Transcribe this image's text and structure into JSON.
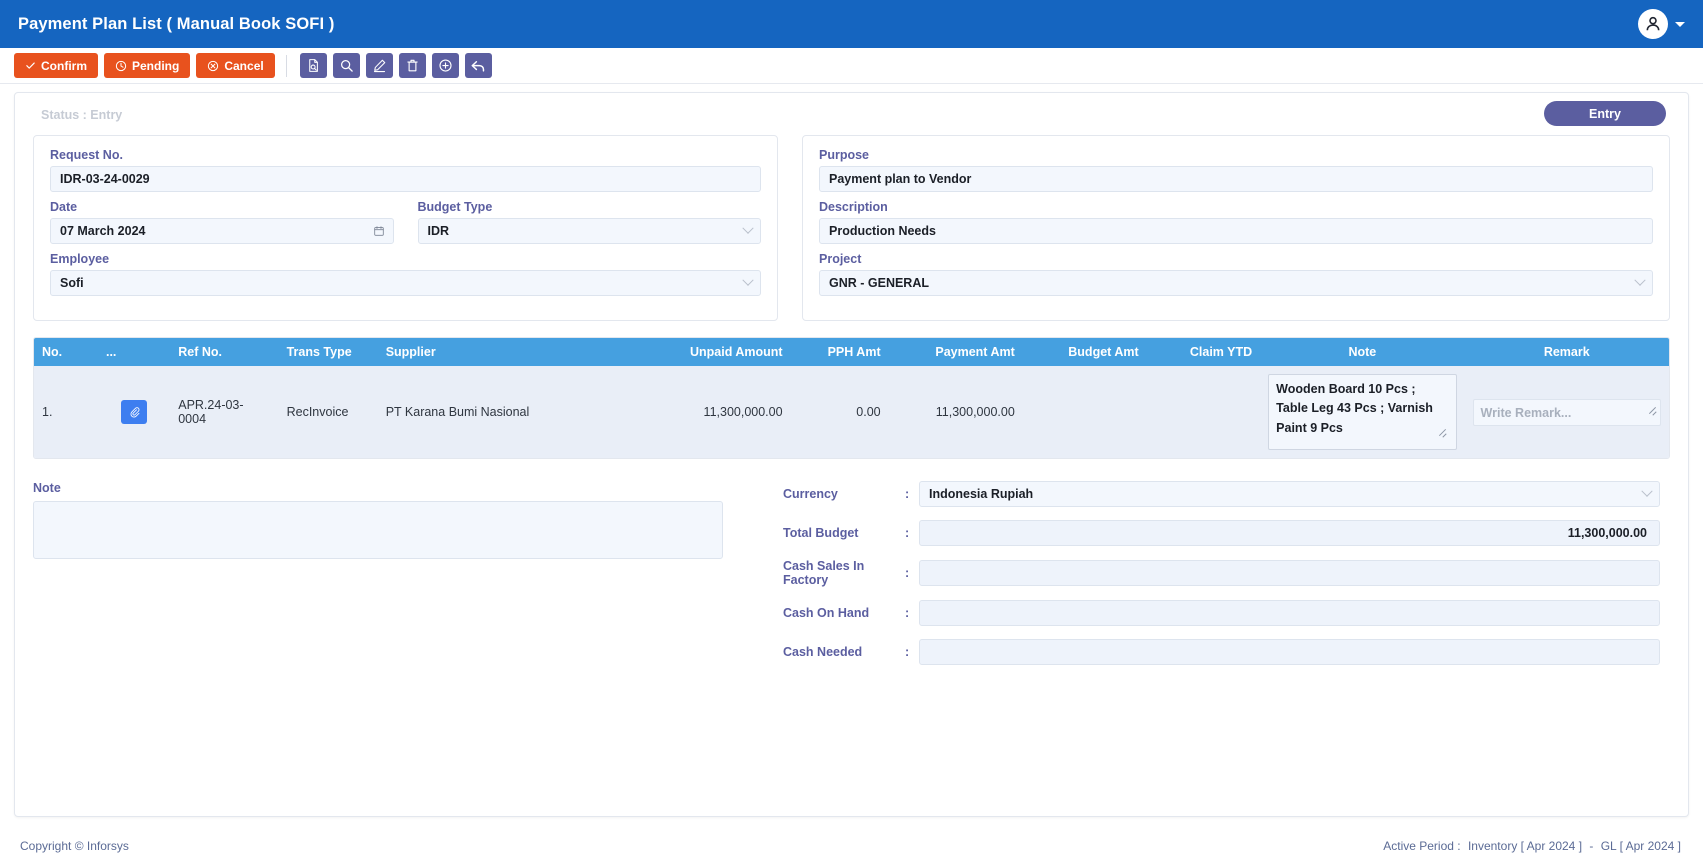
{
  "header": {
    "title": "Payment Plan List ( Manual Book SOFI )",
    "avatar_icon": "user-icon",
    "caret_icon": "chevron-down-icon"
  },
  "toolbar": {
    "actions": [
      {
        "label": "Confirm",
        "icon": "check-icon",
        "color": "#e8521e"
      },
      {
        "label": "Pending",
        "icon": "clock-icon",
        "color": "#e8521e"
      },
      {
        "label": "Cancel",
        "icon": "cancel-circle-icon",
        "color": "#e8521e"
      }
    ],
    "icon_buttons": [
      {
        "name": "document-search-icon",
        "title": "View"
      },
      {
        "name": "search-icon",
        "title": "Search"
      },
      {
        "name": "pencil-edit-icon",
        "title": "Edit"
      },
      {
        "name": "trash-icon",
        "title": "Delete"
      },
      {
        "name": "plus-circle-icon",
        "title": "Add"
      },
      {
        "name": "back-arrow-icon",
        "title": "Back"
      }
    ]
  },
  "page": {
    "status_text": "Status : Entry",
    "entry_badge": "Entry"
  },
  "form": {
    "left": {
      "request_no": {
        "label": "Request No.",
        "value": "IDR-03-24-0029"
      },
      "date": {
        "label": "Date",
        "value": "07 March 2024",
        "icon": "calendar-icon"
      },
      "budget_type": {
        "label": "Budget Type",
        "value": "IDR"
      },
      "employee": {
        "label": "Employee",
        "value": "Sofi"
      }
    },
    "right": {
      "purpose": {
        "label": "Purpose",
        "value": "Payment plan to Vendor"
      },
      "description": {
        "label": "Description",
        "value": "Production Needs"
      },
      "project": {
        "label": "Project",
        "value": "GNR - GENERAL"
      }
    }
  },
  "table": {
    "columns": [
      "No.",
      "...",
      "Ref No.",
      "Trans Type",
      "Supplier",
      "Unpaid Amount",
      "PPH Amt",
      "Payment Amt",
      "Budget Amt",
      "Claim YTD",
      "Note",
      "Remark"
    ],
    "rows": [
      {
        "no": "1.",
        "attach_icon": "paperclip-icon",
        "ref_no": "APR.24-03-0004",
        "trans_type": "RecInvoice",
        "supplier": "PT Karana Bumi Nasional",
        "unpaid_amount": "11,300,000.00",
        "pph_amt": "0.00",
        "payment_amt": "11,300,000.00",
        "budget_amt": "",
        "claim_ytd": "",
        "note": "Wooden Board 10 Pcs ; Table Leg 43 Pcs ; Varnish Paint 9 Pcs",
        "remark_value": "",
        "remark_placeholder": "Write Remark..."
      }
    ]
  },
  "bottom": {
    "note_label": "Note",
    "note_value": "",
    "summary": [
      {
        "label": "Currency",
        "value": "Indonesia Rupiah",
        "type": "select",
        "align": "left"
      },
      {
        "label": "Total Budget",
        "value": "11,300,000.00",
        "type": "text",
        "align": "right"
      },
      {
        "label": "Cash Sales In Factory",
        "value": "",
        "type": "text",
        "align": "right"
      },
      {
        "label": "Cash On Hand",
        "value": "",
        "type": "text",
        "align": "right"
      },
      {
        "label": "Cash Needed",
        "value": "",
        "type": "text",
        "align": "right"
      }
    ]
  },
  "footer": {
    "copyright": "Copyright © Inforsys",
    "active_period_label": "Active Period :",
    "inventory_period": "Inventory [ Apr 2024 ]",
    "separator": "-",
    "gl_period": "GL [ Apr 2024 ]"
  },
  "colors": {
    "header_blue": "#1565c0",
    "action_orange": "#e8521e",
    "icon_purple": "#5b5ea0",
    "grid_header_blue": "#45a0e0",
    "grid_row_bg": "#e9eef7",
    "field_bg": "#f3f7fd",
    "label_purple": "#5b5ea0"
  }
}
